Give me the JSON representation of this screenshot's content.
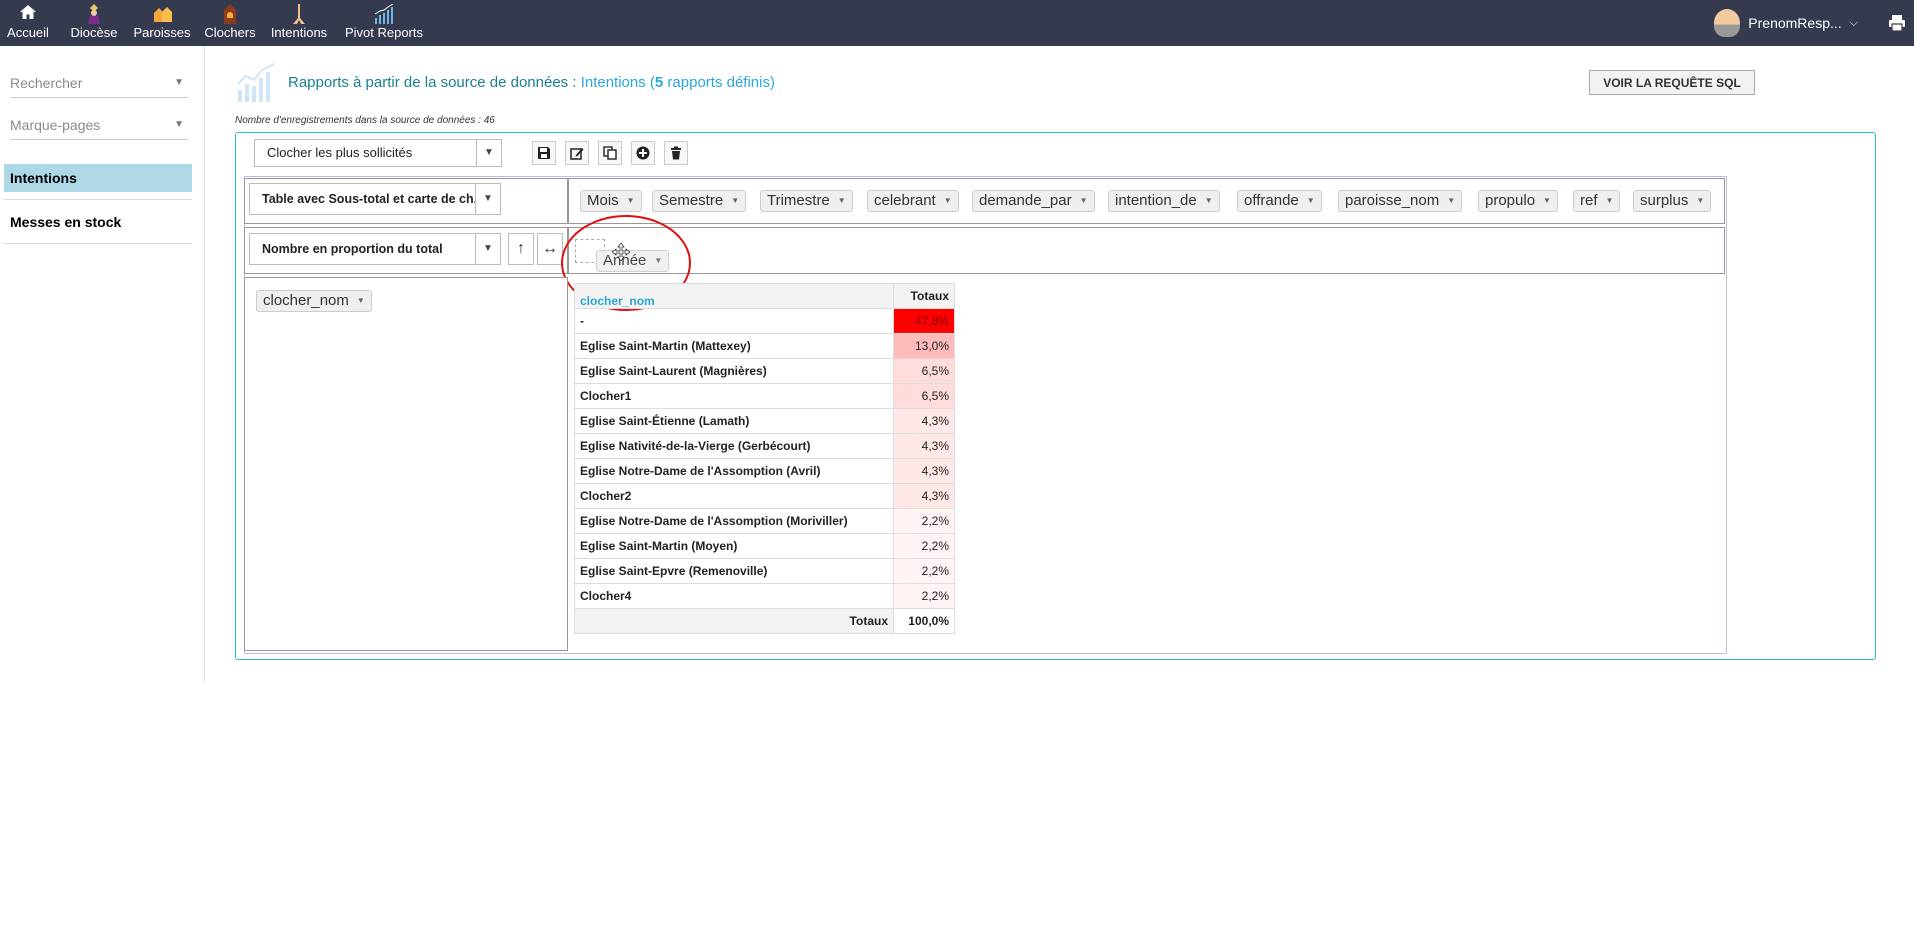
{
  "topnav": {
    "items": [
      {
        "label": "Accueil",
        "icon": "home-icon"
      },
      {
        "label": "Diocèse",
        "icon": "bishop-icon"
      },
      {
        "label": "Paroisses",
        "icon": "parish-icon"
      },
      {
        "label": "Clochers",
        "icon": "bell-tower-icon"
      },
      {
        "label": "Intentions",
        "icon": "praying-hands-icon"
      },
      {
        "label": "Pivot Reports",
        "icon": "bar-chart-icon"
      }
    ],
    "user": "PrenomResp..."
  },
  "sidebar": {
    "search_placeholder": "Rechercher",
    "bookmarks_placeholder": "Marque-pages",
    "items": [
      {
        "label": "Intentions",
        "active": true
      },
      {
        "label": "Messes en stock",
        "active": false
      }
    ]
  },
  "header": {
    "title_prefix": "Rapports à partir de la source de données : ",
    "source": "Intentions",
    "count_open": " (",
    "count": "5",
    "count_suffix": " rapports définis)",
    "sql_button": "VOIR LA REQUÊTE SQL",
    "records_note": "Nombre d'enregistrements dans la source de données : 46"
  },
  "report": {
    "selected": "Clocher les plus sollicités",
    "renderer": "Table avec Sous-total et carte de ch...",
    "aggregator": "Nombre en proportion du total",
    "sort_rows_glyph": "↑",
    "sort_cols_glyph": "↔"
  },
  "fields": {
    "unused": [
      "Mois",
      "Semestre",
      "Trimestre",
      "celebrant",
      "demande_par",
      "intention_de",
      "offrande",
      "paroisse_nom",
      "propulo",
      "ref",
      "surplus"
    ],
    "columns_dragging": "Année",
    "rows": [
      "clocher_nom"
    ]
  },
  "table": {
    "row_header": "clocher_nom",
    "total_header": "Totaux",
    "rows": [
      {
        "label": "-",
        "value": "47,8%",
        "pct": 47.8
      },
      {
        "label": "Eglise Saint-Martin (Mattexey)",
        "value": "13,0%",
        "pct": 13.0
      },
      {
        "label": "Eglise Saint-Laurent (Magnières)",
        "value": "6,5%",
        "pct": 6.5
      },
      {
        "label": "Clocher1",
        "value": "6,5%",
        "pct": 6.5
      },
      {
        "label": "Eglise Saint-Étienne (Lamath)",
        "value": "4,3%",
        "pct": 4.3
      },
      {
        "label": "Eglise Nativité-de-la-Vierge (Gerbécourt)",
        "value": "4,3%",
        "pct": 4.3
      },
      {
        "label": "Eglise Notre-Dame de l'Assomption (Avril)",
        "value": "4,3%",
        "pct": 4.3
      },
      {
        "label": "Clocher2",
        "value": "4,3%",
        "pct": 4.3
      },
      {
        "label": "Eglise Notre-Dame de l'Assomption (Moriviller)",
        "value": "2,2%",
        "pct": 2.2
      },
      {
        "label": "Eglise Saint-Martin (Moyen)",
        "value": "2,2%",
        "pct": 2.2
      },
      {
        "label": "Eglise Saint-Epvre (Remenoville)",
        "value": "2,2%",
        "pct": 2.2
      },
      {
        "label": "Clocher4",
        "value": "2,2%",
        "pct": 2.2
      }
    ],
    "total_label": "Totaux",
    "total_value": "100,0%"
  },
  "colors": {
    "nav_bg": "#363a4f",
    "accent": "#2aa6d8",
    "title": "#1a7f8f",
    "active_item": "#add8e6",
    "heat_max": "#ff0000",
    "annotation": "#e01010"
  }
}
